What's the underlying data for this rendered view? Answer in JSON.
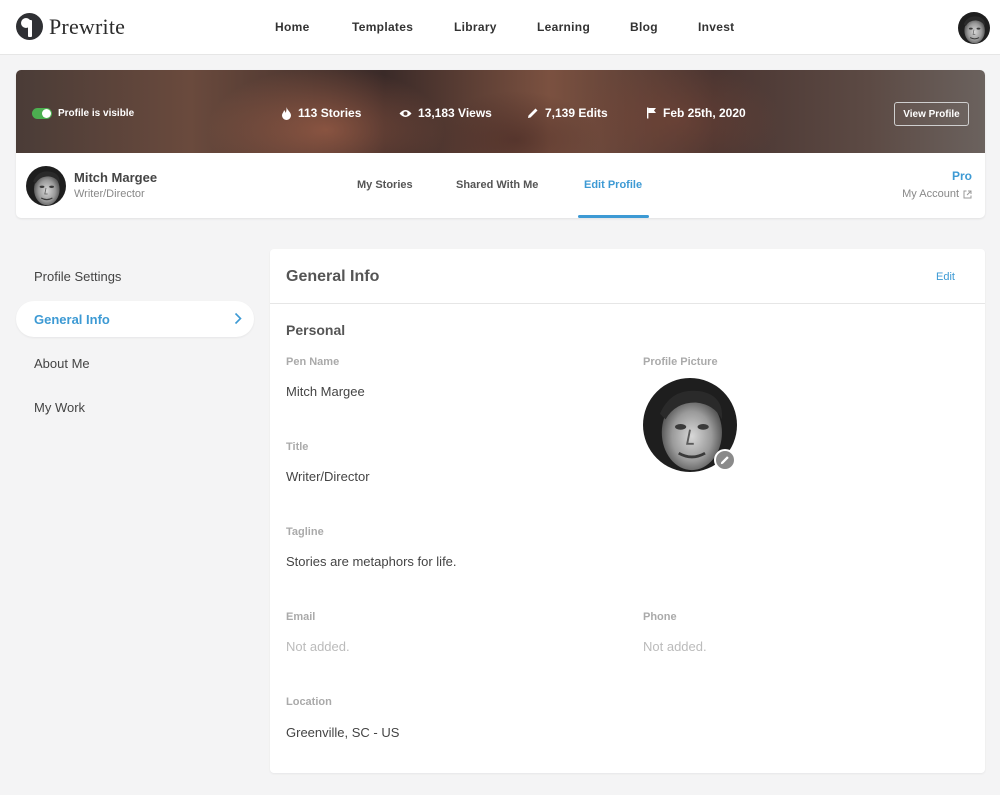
{
  "app": {
    "name": "Prewrite"
  },
  "nav": {
    "links": [
      "Home",
      "Templates",
      "Library",
      "Learning",
      "Blog",
      "Invest"
    ]
  },
  "banner": {
    "visibility_label": "Profile is visible",
    "stats": {
      "stories": "113 Stories",
      "views": "13,183 Views",
      "edits": "7,139 Edits",
      "joined": "Feb 25th, 2020"
    },
    "view_profile_label": "View Profile"
  },
  "profile": {
    "name": "Mitch Margee",
    "title": "Writer/Director",
    "plan": "Pro",
    "account_label": "My Account"
  },
  "profile_tabs": [
    "My Stories",
    "Shared With Me",
    "Edit Profile"
  ],
  "active_profile_tab": "Edit Profile",
  "sidebar": {
    "items": [
      "Profile Settings",
      "General Info",
      "About Me",
      "My Work"
    ],
    "active": "General Info"
  },
  "panel": {
    "title": "General Info",
    "edit_label": "Edit",
    "section": "Personal",
    "fields": {
      "pen_name": {
        "label": "Pen Name",
        "value": "Mitch Margee"
      },
      "title": {
        "label": "Title",
        "value": "Writer/Director"
      },
      "tagline": {
        "label": "Tagline",
        "value": "Stories are metaphors for life."
      },
      "email": {
        "label": "Email",
        "value": "Not added."
      },
      "phone": {
        "label": "Phone",
        "value": "Not added."
      },
      "location": {
        "label": "Location",
        "value": "Greenville, SC - US"
      },
      "picture": {
        "label": "Profile Picture"
      }
    }
  },
  "colors": {
    "accent": "#3d9ad4",
    "toggle_on": "#4caf50"
  }
}
